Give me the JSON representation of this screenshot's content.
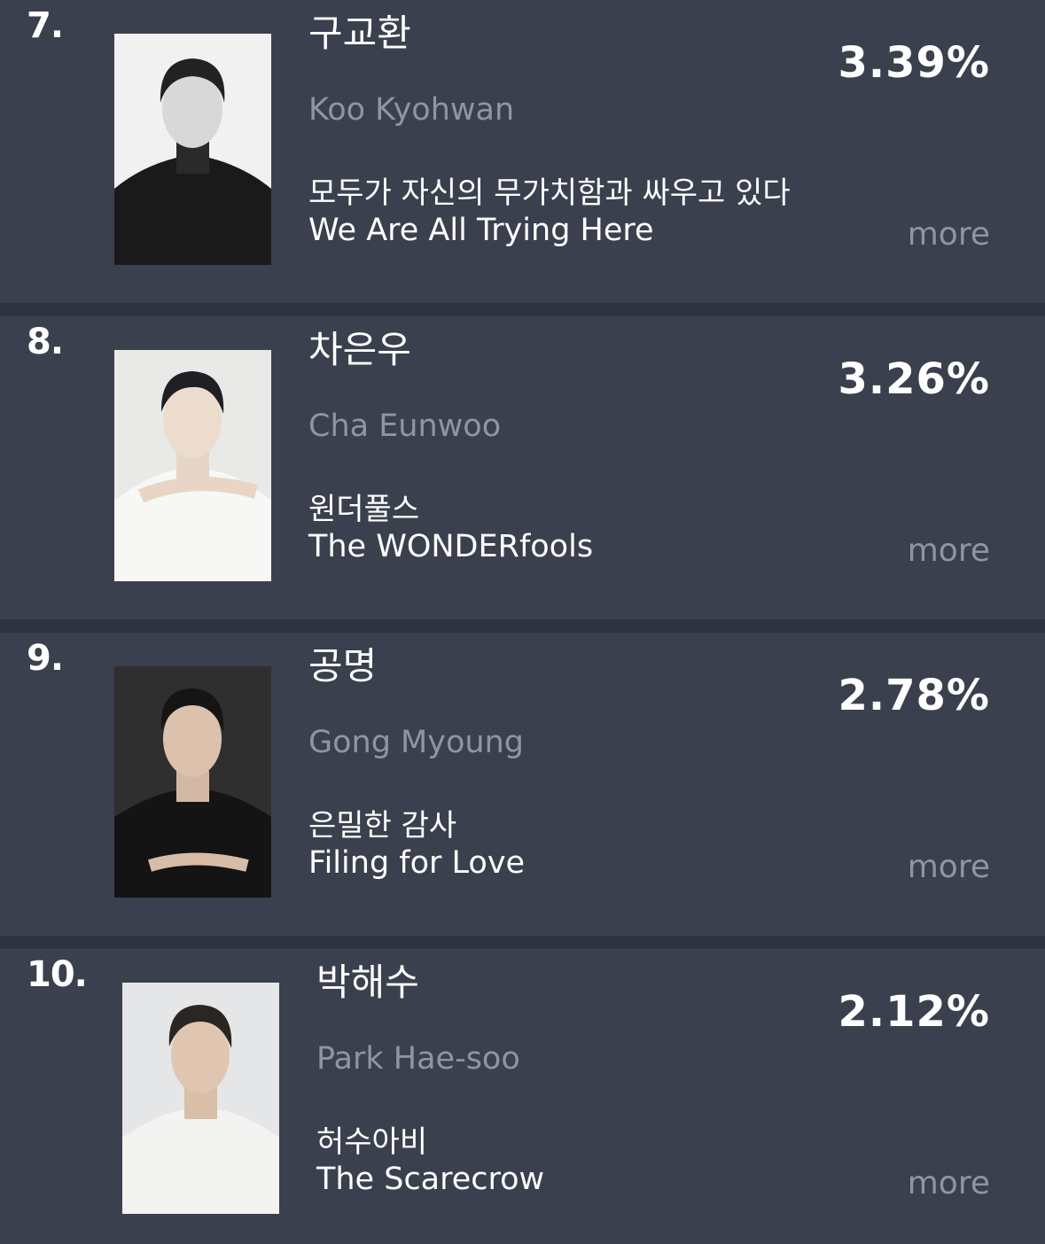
{
  "rankings": [
    {
      "rank": "7.",
      "name_ko": "구교환",
      "name_en": "Koo Kyohwan",
      "drama_ko": "모두가 자신의 무가치함과 싸우고 있다",
      "drama_en": "We Are All Trying Here",
      "percent": "3.39%",
      "more": "more"
    },
    {
      "rank": "8.",
      "name_ko": "차은우",
      "name_en": "Cha Eunwoo",
      "drama_ko": "원더풀스",
      "drama_en": "The WONDERfools",
      "percent": "3.26%",
      "more": "more"
    },
    {
      "rank": "9.",
      "name_ko": "공명",
      "name_en": "Gong Myoung",
      "drama_ko": "은밀한 감사",
      "drama_en": "Filing for Love",
      "percent": "2.78%",
      "more": "more"
    },
    {
      "rank": "10.",
      "name_ko": "박해수",
      "name_en": "Park Hae-soo",
      "drama_ko": "허수아비",
      "drama_en": "The Scarecrow",
      "percent": "2.12%",
      "more": "more"
    }
  ]
}
